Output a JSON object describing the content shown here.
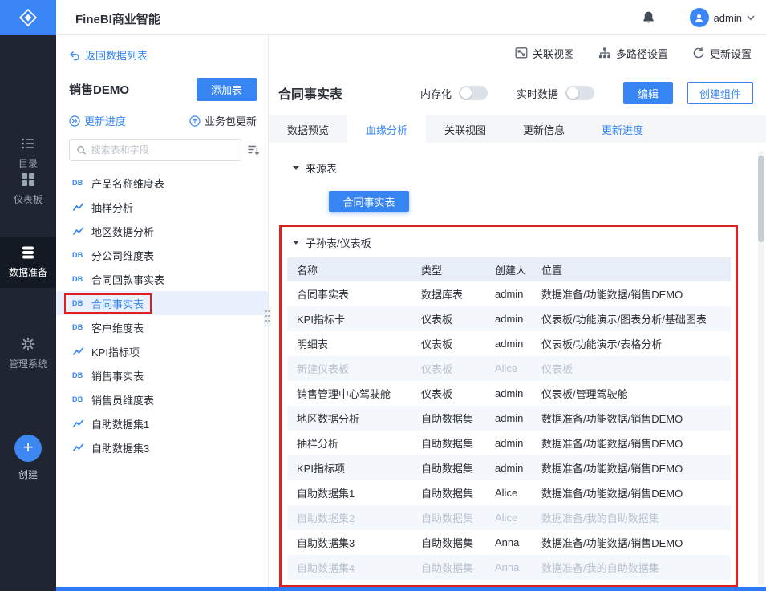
{
  "colors": {
    "accent": "#3685f2",
    "annotation": "#e01e1e",
    "sidebar_bg": "#1f2531"
  },
  "header": {
    "app_title": "FineBI商业智能",
    "user_name": "admin"
  },
  "sidebar": {
    "items": [
      {
        "label": "目录"
      },
      {
        "label": "仪表板"
      },
      {
        "label": "数据准备",
        "active": true
      },
      {
        "label": "管理系统"
      },
      {
        "label": "创建"
      }
    ]
  },
  "panel": {
    "back_link": "返回数据列表",
    "package_title": "销售DEMO",
    "add_table_button": "添加表",
    "update_progress": "更新进度",
    "package_update": "业务包更新",
    "search_placeholder": "搜索表和字段",
    "tables": [
      {
        "name": "产品名称维度表",
        "kind": "db"
      },
      {
        "name": "抽样分析",
        "kind": "chart"
      },
      {
        "name": "地区数据分析",
        "kind": "chart"
      },
      {
        "name": "分公司维度表",
        "kind": "db"
      },
      {
        "name": "合同回款事实表",
        "kind": "db"
      },
      {
        "name": "合同事实表",
        "kind": "db",
        "selected": true
      },
      {
        "name": "客户维度表",
        "kind": "db"
      },
      {
        "name": "KPI指标项",
        "kind": "chart"
      },
      {
        "name": "销售事实表",
        "kind": "db"
      },
      {
        "name": "销售员维度表",
        "kind": "db"
      },
      {
        "name": "自助数据集1",
        "kind": "chart"
      },
      {
        "name": "自助数据集3",
        "kind": "chart"
      }
    ]
  },
  "toolbar": {
    "link_relation_view": "关联视图",
    "link_multipath": "多路径设置",
    "link_update_settings": "更新设置"
  },
  "main": {
    "title": "合同事实表",
    "memory_toggle_label": "内存化",
    "realtime_toggle_label": "实时数据",
    "edit_button": "编辑",
    "create_component_button": "创建组件",
    "tabs": [
      {
        "label": "数据预览"
      },
      {
        "label": "血缘分析",
        "active": true
      },
      {
        "label": "关联视图"
      },
      {
        "label": "更新信息"
      },
      {
        "label": "更新进度",
        "blue": true
      }
    ],
    "source_section_title": "来源表",
    "source_node_label": "合同事实表",
    "descendants_section_title": "子孙表/仪表板",
    "table": {
      "headers": [
        "名称",
        "类型",
        "创建人",
        "位置"
      ],
      "rows": [
        {
          "cells": [
            "合同事实表",
            "数据库表",
            "admin",
            "数据准备/功能数据/销售DEMO"
          ]
        },
        {
          "cells": [
            "KPI指标卡",
            "仪表板",
            "admin",
            "仪表板/功能演示/图表分析/基础图表"
          ]
        },
        {
          "cells": [
            "明细表",
            "仪表板",
            "admin",
            "仪表板/功能演示/表格分析"
          ]
        },
        {
          "cells": [
            "新建仪表板",
            "仪表板",
            "Alice",
            "仪表板"
          ],
          "disabled": true
        },
        {
          "cells": [
            "销售管理中心驾驶舱",
            "仪表板",
            "admin",
            "仪表板/管理驾驶舱"
          ]
        },
        {
          "cells": [
            "地区数据分析",
            "自助数据集",
            "admin",
            "数据准备/功能数据/销售DEMO"
          ]
        },
        {
          "cells": [
            "抽样分析",
            "自助数据集",
            "admin",
            "数据准备/功能数据/销售DEMO"
          ]
        },
        {
          "cells": [
            "KPI指标项",
            "自助数据集",
            "admin",
            "数据准备/功能数据/销售DEMO"
          ]
        },
        {
          "cells": [
            "自助数据集1",
            "自助数据集",
            "Alice",
            "数据准备/功能数据/销售DEMO"
          ]
        },
        {
          "cells": [
            "自助数据集2",
            "自助数据集",
            "Alice",
            "数据准备/我的自助数据集"
          ],
          "disabled": true
        },
        {
          "cells": [
            "自助数据集3",
            "自助数据集",
            "Anna",
            "数据准备/功能数据/销售DEMO"
          ]
        },
        {
          "cells": [
            "自助数据集4",
            "自助数据集",
            "Anna",
            "数据准备/我的自助数据集"
          ],
          "disabled": true
        }
      ]
    }
  }
}
